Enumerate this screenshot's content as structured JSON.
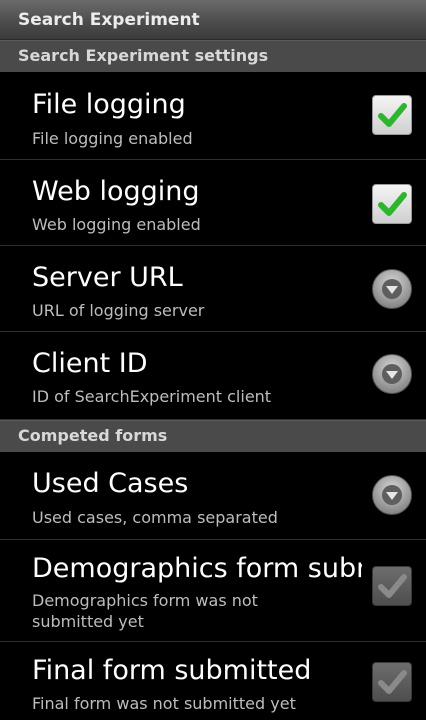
{
  "window": {
    "title": "Search Experiment"
  },
  "sections": {
    "settings": "Search Experiment settings",
    "forms": "Competed forms"
  },
  "prefs": {
    "file_logging": {
      "title": "File logging",
      "summary": "File logging enabled",
      "checked": true,
      "enabled": true
    },
    "web_logging": {
      "title": "Web logging",
      "summary": "Web logging enabled",
      "checked": true,
      "enabled": true
    },
    "server_url": {
      "title": "Server URL",
      "summary": "URL of logging server"
    },
    "client_id": {
      "title": "Client ID",
      "summary": "ID of SearchExperiment client"
    },
    "used_cases": {
      "title": "Used Cases",
      "summary": "Used cases, comma separated"
    },
    "demographics": {
      "title": "Demographics form submitted",
      "summary": "Demographics form was not submitted yet",
      "checked": true,
      "enabled": false
    },
    "final_form": {
      "title": "Final form submitted",
      "summary": "Final form was not submitted yet",
      "checked": true,
      "enabled": false
    }
  },
  "colors": {
    "check_enabled": "#2eb52e",
    "check_disabled": "#8a8a8a",
    "title_bar": "#4a4a4a",
    "section_header": "#4a4a4a"
  },
  "icons": {
    "checkbox": "check-icon",
    "dropdown": "dropdown-arrow-icon"
  }
}
